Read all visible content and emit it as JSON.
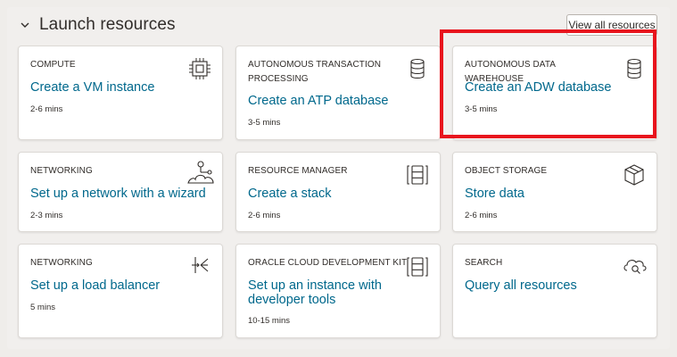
{
  "section": {
    "title": "Launch resources",
    "view_all_label": "View all resources"
  },
  "cards": [
    {
      "category": "COMPUTE",
      "action": "Create a VM instance",
      "time": "2-6 mins",
      "icon": "chip-icon"
    },
    {
      "category": "AUTONOMOUS TRANSACTION PROCESSING",
      "action": "Create an ATP database",
      "time": "3-5 mins",
      "icon": "database-icon"
    },
    {
      "category": "AUTONOMOUS DATA WAREHOUSE",
      "action": "Create an ADW database",
      "time": "3-5 mins",
      "icon": "database-icon"
    },
    {
      "category": "NETWORKING",
      "action": "Set up a network with a wizard",
      "time": "2-3 mins",
      "icon": "network-icon"
    },
    {
      "category": "RESOURCE MANAGER",
      "action": "Create a stack",
      "time": "2-6 mins",
      "icon": "stack-icon"
    },
    {
      "category": "OBJECT STORAGE",
      "action": "Store data",
      "time": "2-6 mins",
      "icon": "box-icon"
    },
    {
      "category": "NETWORKING",
      "action": "Set up a load balancer",
      "time": "5 mins",
      "icon": "load-balancer-icon"
    },
    {
      "category": "ORACLE CLOUD DEVELOPMENT KIT",
      "action": "Set up an instance with developer tools",
      "time": "10-15 mins",
      "icon": "stack-icon"
    },
    {
      "category": "SEARCH",
      "action": "Query all resources",
      "time": "",
      "icon": "cloud-search-icon"
    }
  ],
  "highlighted_card": "AUTONOMOUS DATA WAREHOUSE",
  "colors": {
    "link": "#00688c",
    "text": "#312d2a",
    "highlight": "#e8141d",
    "background": "#f1efed"
  }
}
